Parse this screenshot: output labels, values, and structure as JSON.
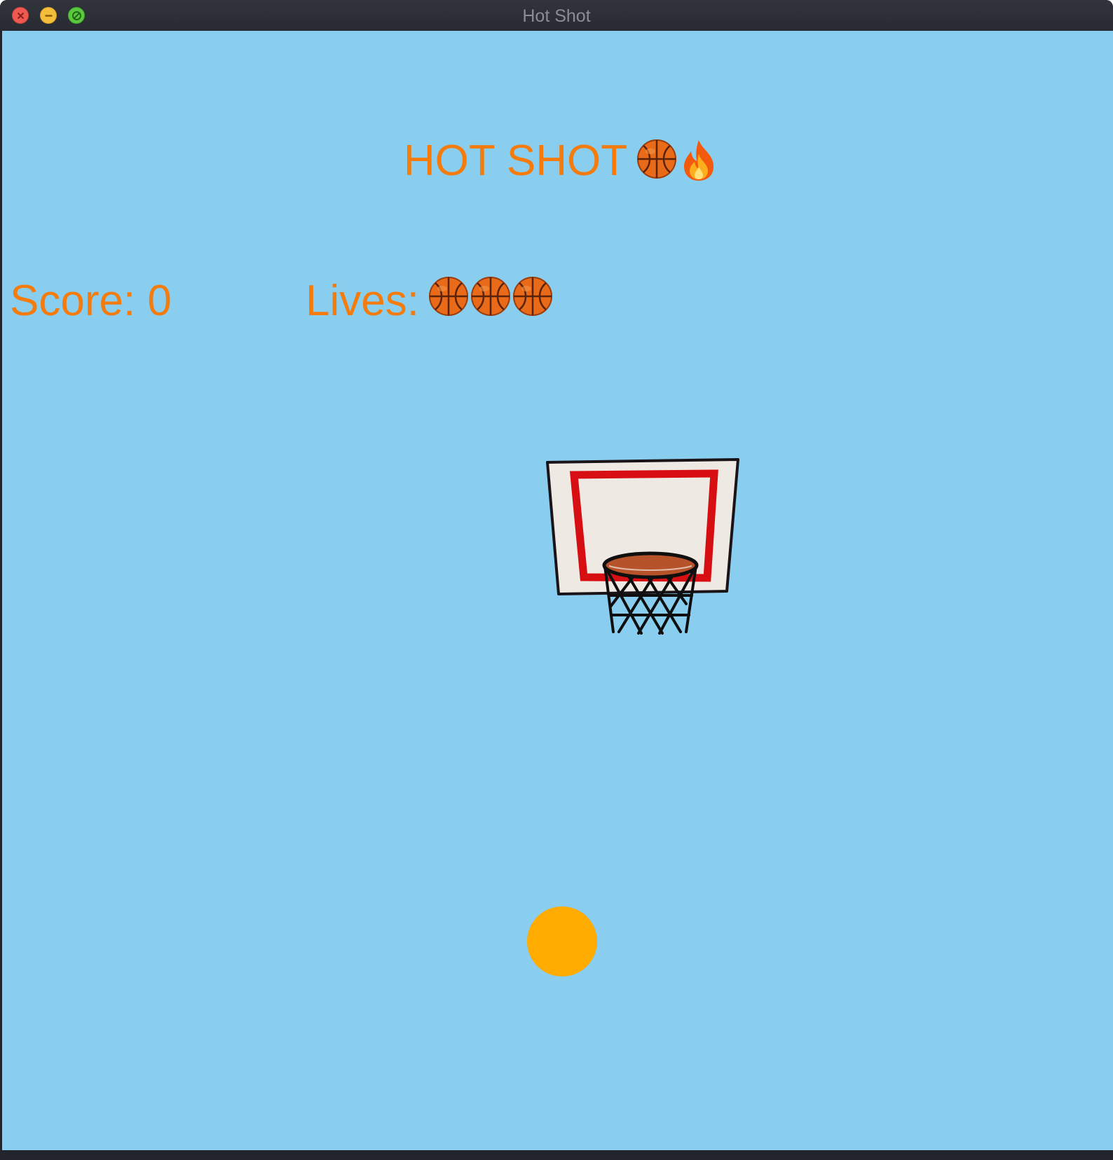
{
  "window": {
    "title": "Hot Shot"
  },
  "game": {
    "title": "HOT SHOT",
    "title_icons": [
      "basketball-icon",
      "fire-icon"
    ],
    "score_label": "Score: 0",
    "score": 0,
    "lives_label": "Lives:",
    "lives": 3,
    "life_icon": "basketball-icon"
  },
  "colors": {
    "sky": "#89cdef",
    "text": "#f57c0c",
    "ball": "#ffab00",
    "backboard": "#efe9e3",
    "backboard_square": "#d70f12",
    "rim": "#b6532a"
  }
}
